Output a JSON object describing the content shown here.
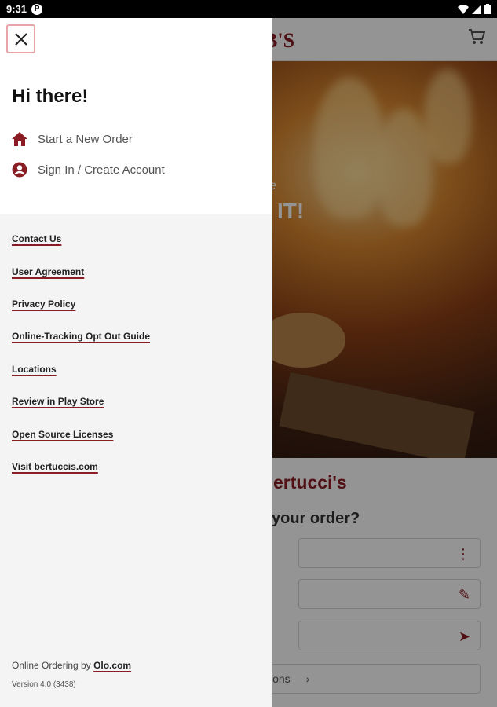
{
  "status_bar": {
    "time": "9:31",
    "app_icon": "P"
  },
  "background": {
    "logo": "B'S",
    "hero_small": "e",
    "hero_text": "IT!",
    "brand": "ertucci's",
    "question": "your order?",
    "locations": "ions"
  },
  "drawer": {
    "greeting": "Hi there!",
    "nav": [
      {
        "label": "Start a New Order",
        "icon": "home-icon"
      },
      {
        "label": "Sign In / Create Account",
        "icon": "account-circle-icon"
      }
    ],
    "links": [
      "Contact Us",
      "User Agreement",
      "Privacy Policy",
      "Online-Tracking Opt Out Guide",
      "Locations",
      "Review in Play Store",
      "Open Source Licenses",
      "Visit bertuccis.com"
    ],
    "footer": {
      "prefix": "Online Ordering by ",
      "olo_link": "Olo.com",
      "version": "Version 4.0 (3438)"
    }
  },
  "colors": {
    "accent": "#8a1d24",
    "close_border": "#e8a4a8",
    "drawer_bg": "#f4f4f4"
  }
}
